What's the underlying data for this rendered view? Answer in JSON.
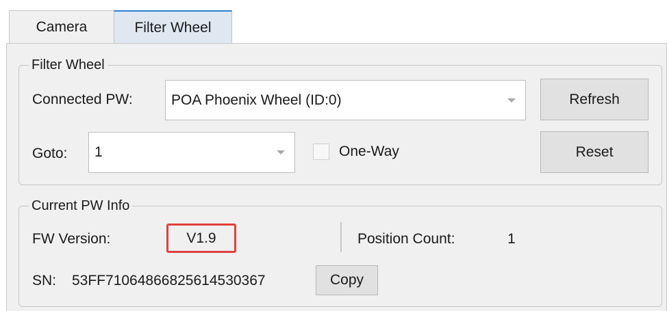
{
  "tabs": [
    {
      "label": "Camera",
      "active": false
    },
    {
      "label": "Filter Wheel",
      "active": true
    }
  ],
  "filter_wheel_group": {
    "title": "Filter Wheel",
    "connected_label": "Connected PW:",
    "connected_value": "POA Phoenix Wheel (ID:0)",
    "refresh_label": "Refresh",
    "goto_label": "Goto:",
    "goto_value": "1",
    "one_way_label": "One-Way",
    "one_way_checked": false,
    "reset_label": "Reset"
  },
  "info_group": {
    "title": "Current PW Info",
    "fw_version_label": "FW Version:",
    "fw_version_value": "V1.9",
    "position_count_label": "Position Count:",
    "position_count_value": "1",
    "sn_label": "SN:",
    "sn_value": "53FF71064866825614530367",
    "copy_label": "Copy"
  },
  "colors": {
    "highlight_border": "#e0403d",
    "active_tab_accent": "#2f7fd1",
    "panel_bg": "#f0f0f0"
  }
}
